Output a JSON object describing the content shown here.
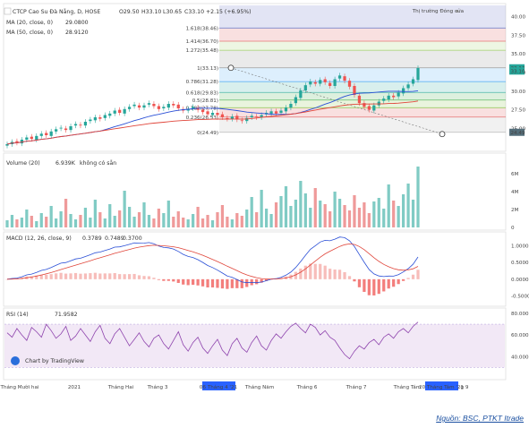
{
  "chart_data": {
    "type": "line",
    "title": "CTCP Cao Su Đà Nẵng, D, HOSE",
    "ohlc": {
      "open": "O29.50",
      "high": "H33.10",
      "low": "L30.65",
      "close": "C33.10",
      "change": "+2.15 (+6.95%)"
    },
    "market_status": "Thị trường Đóng cửa",
    "price_axis": {
      "ticks": [
        "40.00",
        "37.50",
        "35.00",
        "32.50",
        "30.00",
        "27.50",
        "25.00"
      ],
      "range": [
        22.3,
        41.5
      ]
    },
    "price_tags": {
      "last": "33.10",
      "prev": "33.13",
      "low": "24.49"
    },
    "ma": [
      {
        "name": "MA (20, close, 0)",
        "value": "29.0800",
        "color": "#2a4fd6"
      },
      {
        "name": "MA (50, close, 0)",
        "value": "28.9120",
        "color": "#e0453a"
      }
    ],
    "fibonacci": {
      "levels": [
        {
          "ratio": 0,
          "label": "0(24.49)",
          "price": 24.49,
          "color": "#bdbdbd"
        },
        {
          "ratio": 0.236,
          "label": "0.236(26.53)",
          "price": 26.53,
          "color": "#e57373"
        },
        {
          "ratio": 0.382,
          "label": "0.382(27.78)",
          "price": 27.78,
          "color": "#9ccc65"
        },
        {
          "ratio": 0.5,
          "label": "0.5(28.81)",
          "price": 28.81,
          "color": "#66bb6a"
        },
        {
          "ratio": 0.618,
          "label": "0.618(29.83)",
          "price": 29.83,
          "color": "#4db6ac"
        },
        {
          "ratio": 0.786,
          "label": "0.786(31.28)",
          "price": 31.28,
          "color": "#64b5f6"
        },
        {
          "ratio": 1,
          "label": "1(33.13)",
          "price": 33.13,
          "color": "#9e9e9e"
        },
        {
          "ratio": 1.272,
          "label": "1.272(35.48)",
          "price": 35.48,
          "color": "#aed581"
        },
        {
          "ratio": 1.414,
          "label": "1.414(36.70)",
          "price": 36.7,
          "color": "#e57373"
        },
        {
          "ratio": 1.618,
          "label": "1.618(38.46)",
          "price": 38.46,
          "color": "#7986cb"
        }
      ],
      "top_label": "1(33.13)"
    },
    "closes": [
      22.9,
      23.2,
      23.1,
      23.5,
      23.8,
      23.6,
      24.0,
      24.3,
      24.1,
      24.6,
      24.9,
      25.1,
      24.8,
      25.3,
      25.6,
      25.4,
      25.9,
      26.2,
      26.5,
      26.3,
      26.8,
      27.0,
      27.4,
      27.1,
      27.6,
      27.9,
      28.2,
      27.8,
      28.1,
      28.4,
      28.0,
      27.6,
      27.9,
      28.3,
      28.1,
      27.7,
      27.4,
      27.6,
      27.9,
      27.5,
      27.2,
      26.9,
      27.1,
      26.8,
      26.5,
      26.3,
      26.6,
      26.2,
      26.0,
      26.4,
      26.7,
      26.5,
      26.8,
      27.1,
      27.3,
      27.0,
      27.4,
      27.8,
      28.3,
      29.2,
      30.1,
      30.8,
      31.3,
      31.0,
      31.5,
      31.2,
      30.7,
      31.6,
      32.1,
      31.4,
      30.6,
      29.5,
      28.4,
      27.9,
      27.5,
      28.1,
      28.6,
      29.0,
      29.4,
      29.2,
      29.8,
      30.4,
      30.9,
      31.6,
      33.1
    ],
    "volume": {
      "label": "Volume (20)",
      "value": "6.939K",
      "note": "không có sẵn",
      "ticks": [
        "6M",
        "4M",
        "2M",
        "0"
      ],
      "max": 7.2,
      "values": [
        0.8,
        1.4,
        0.9,
        1.1,
        2.0,
        1.3,
        0.7,
        1.6,
        1.2,
        2.4,
        1.0,
        1.8,
        3.2,
        1.5,
        0.9,
        1.4,
        2.2,
        1.1,
        3.1,
        1.7,
        1.0,
        2.6,
        1.3,
        1.9,
        4.1,
        2.3,
        1.2,
        1.7,
        2.8,
        1.4,
        1.0,
        2.1,
        1.6,
        3.0,
        1.2,
        1.8,
        1.1,
        0.9,
        1.5,
        2.3,
        1.0,
        1.4,
        0.8,
        1.7,
        2.5,
        1.2,
        0.9,
        1.6,
        1.3,
        2.0,
        3.4,
        1.7,
        4.2,
        2.1,
        1.5,
        2.8,
        3.5,
        4.6,
        2.4,
        3.1,
        5.2,
        3.8,
        2.2,
        4.4,
        3.0,
        2.6,
        1.8,
        4.0,
        3.2,
        2.5,
        1.9,
        3.6,
        2.2,
        2.8,
        1.6,
        2.9,
        3.3,
        2.1,
        4.8,
        3.0,
        2.4,
        3.7,
        4.9,
        3.1,
        6.8
      ]
    },
    "macd": {
      "label": "MACD (12, 26, close, 9)",
      "values": [
        "0.3789",
        "0.7489",
        "0.3700"
      ],
      "ticks": [
        "1.0000",
        "0.5000",
        "0.0000",
        "-0.5000"
      ],
      "range": [
        -0.7,
        1.12
      ]
    },
    "rsi": {
      "label": "RSI (14)",
      "value": "71.9582",
      "ticks": [
        "80.0000",
        "60.0000",
        "40.0000"
      ],
      "range": [
        22,
        80
      ],
      "values": [
        62,
        58,
        66,
        60,
        55,
        67,
        63,
        58,
        70,
        64,
        57,
        61,
        68,
        55,
        59,
        66,
        60,
        54,
        63,
        69,
        57,
        52,
        61,
        66,
        58,
        50,
        56,
        62,
        54,
        49,
        57,
        60,
        52,
        47,
        55,
        63,
        51,
        45,
        53,
        58,
        48,
        43,
        50,
        56,
        46,
        41,
        52,
        57,
        48,
        44,
        53,
        59,
        50,
        46,
        55,
        61,
        57,
        63,
        68,
        71,
        66,
        62,
        70,
        67,
        60,
        64,
        58,
        55,
        48,
        42,
        38,
        45,
        50,
        47,
        53,
        56,
        51,
        58,
        61,
        57,
        63,
        66,
        62,
        68,
        72
      ]
    },
    "watermark": "Chart by TradingView",
    "time_axis": {
      "ticks": [
        "Tháng Mười hai",
        "2021",
        "Tháng Hai",
        "Tháng 3",
        "Tháng Năm",
        "Tháng 6",
        "Tháng 7",
        "Tháng Tám",
        "g 9"
      ],
      "highlights": [
        "06 Tháng 4 '21",
        "20 Tháng Tám '21"
      ]
    }
  },
  "source": "Nguồn: BSC, PTKT Itrade"
}
